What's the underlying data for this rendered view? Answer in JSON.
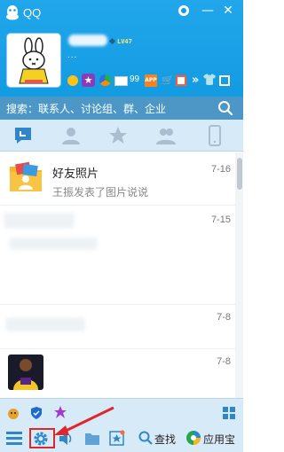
{
  "app": {
    "title": "QQ"
  },
  "profile": {
    "vip_level": "LV47",
    "signature": "...",
    "mail_count": "99",
    "app_badge": "APP"
  },
  "search": {
    "placeholder": "搜索：联系人、讨论组、群、企业"
  },
  "tabs": [
    {
      "name": "messages",
      "active": true
    },
    {
      "name": "contacts"
    },
    {
      "name": "favorites"
    },
    {
      "name": "groups"
    },
    {
      "name": "devices"
    }
  ],
  "messages": [
    {
      "title": "好友照片",
      "preview": "王振发表了图片说说",
      "date": "7-16"
    },
    {
      "title": "",
      "preview": "",
      "date": "7-15"
    },
    {
      "title": "",
      "preview": "",
      "date": "7-8"
    },
    {
      "title": "",
      "preview": "",
      "date": "7-8"
    }
  ],
  "bottom": {
    "find_label": "查找",
    "app_store_label": "应用宝"
  },
  "colors": {
    "header": "#139be2",
    "search_bar": "#4d97c6",
    "tab_bar": "#d6eaf7",
    "highlight": "#e0252b"
  }
}
